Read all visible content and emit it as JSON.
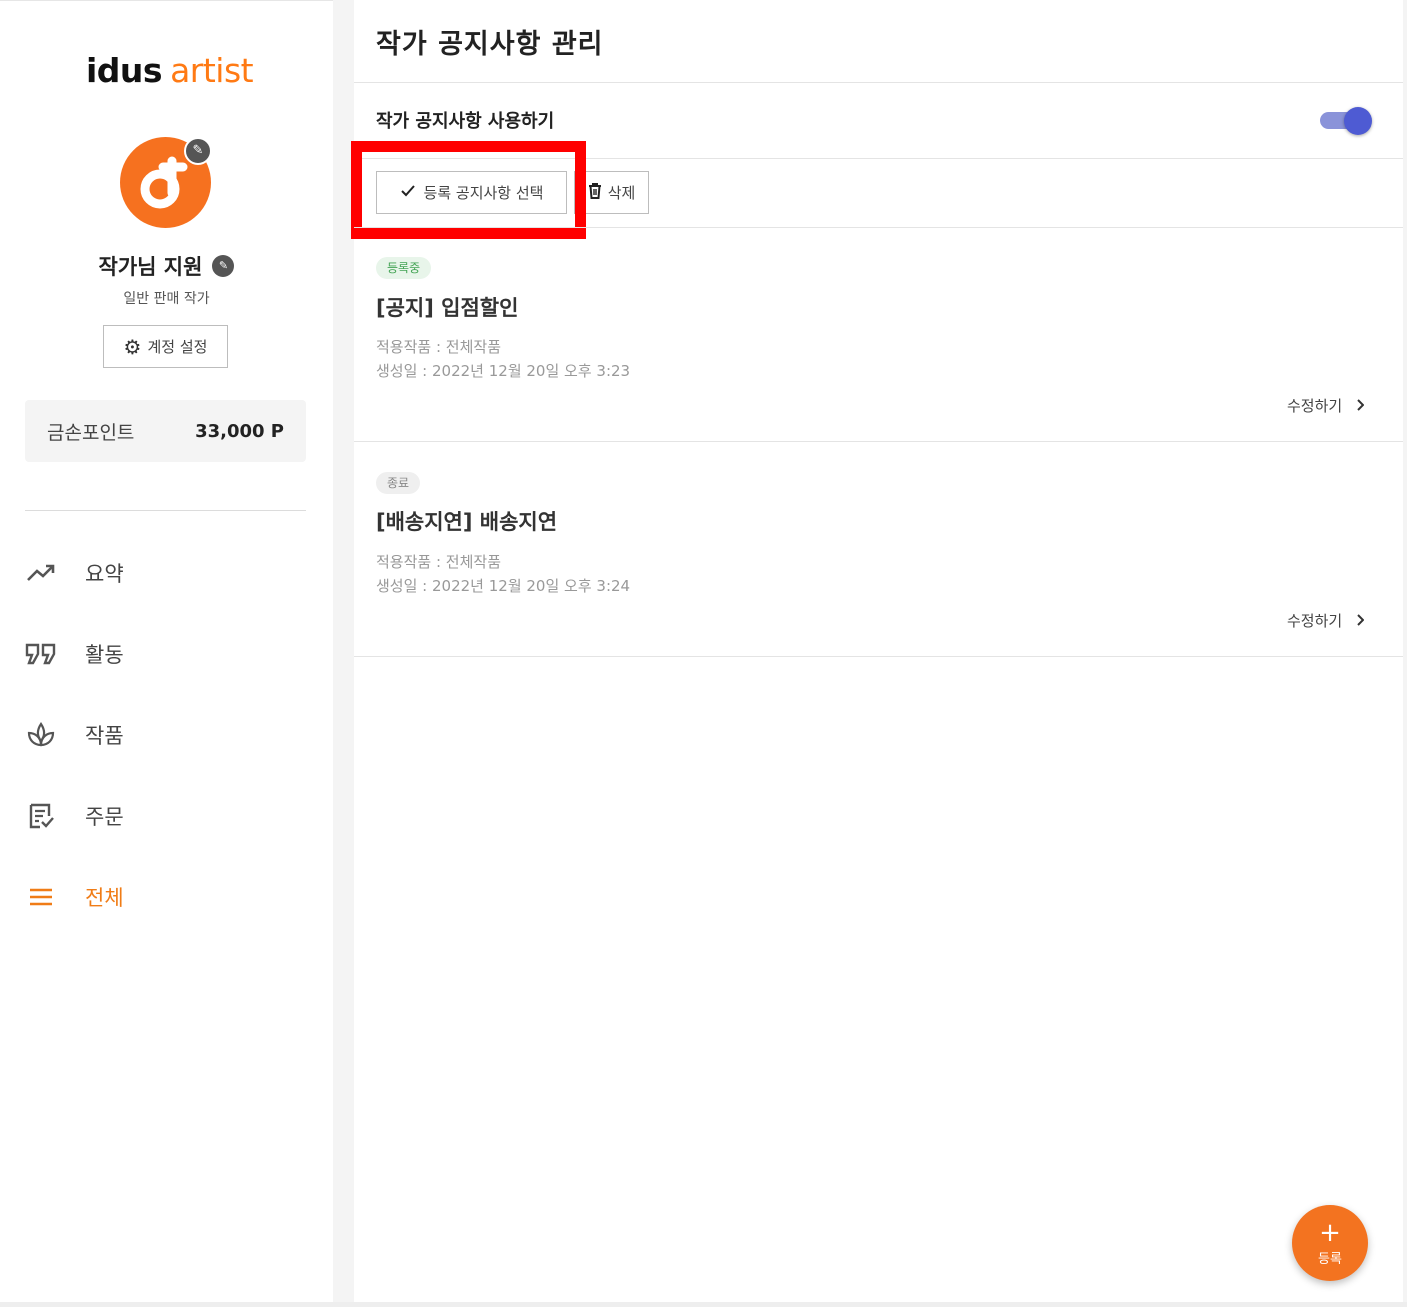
{
  "brand": {
    "logo_main": "idus",
    "logo_sub": "artist"
  },
  "profile": {
    "name": "작가님 지원",
    "role": "일반 판매 작가",
    "account_settings_label": "계정 설정"
  },
  "points": {
    "label": "금손포인트",
    "value": "33,000 P"
  },
  "nav": {
    "items": [
      {
        "label": "요약",
        "icon": "trending-up-icon"
      },
      {
        "label": "활동",
        "icon": "quote-icon"
      },
      {
        "label": "작품",
        "icon": "sprout-icon"
      },
      {
        "label": "주문",
        "icon": "order-list-icon"
      },
      {
        "label": "전체",
        "icon": "menu-icon",
        "active": true
      }
    ]
  },
  "main": {
    "title": "작가 공지사항 관리",
    "toggle_label": "작가 공지사항 사용하기",
    "toggle_on": true,
    "select_button_label": "등록 공지사항 선택",
    "delete_button_label": "삭제",
    "notices": [
      {
        "status": "등록중",
        "title": "[공지] 입점할인",
        "applied": "적용작품 : 전체작품",
        "created": "생성일 : 2022년 12월 20일 오후 3:23",
        "edit_label": "수정하기"
      },
      {
        "status": "종료",
        "title": "[배송지연] 배송지연",
        "applied": "적용작품 : 전체작품",
        "created": "생성일 : 2022년 12월 20일 오후 3:24",
        "edit_label": "수정하기"
      }
    ]
  },
  "fab": {
    "plus": "+",
    "label": "등록"
  },
  "colors": {
    "accent": "#f37320",
    "toggle": "#4e5bd3",
    "highlight": "#ff0000",
    "active_badge": "#44a455"
  }
}
